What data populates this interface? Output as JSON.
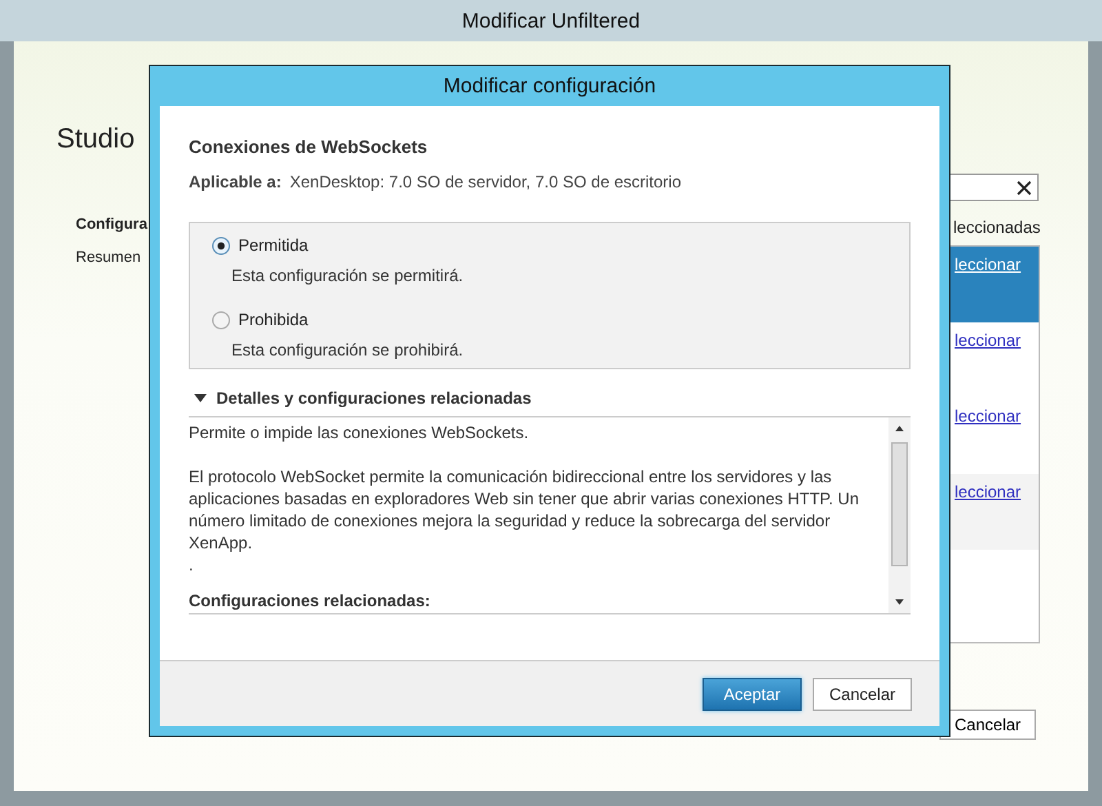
{
  "background_window": {
    "title": "Modificar Unfiltered",
    "heading": "Studio",
    "steps": [
      {
        "label": "Configura",
        "selected": true
      },
      {
        "label": "Resumen",
        "selected": false
      }
    ],
    "list_header": "leccionadas",
    "rows": [
      {
        "link": "leccionar",
        "selected": true
      },
      {
        "link": "leccionar",
        "selected": false
      },
      {
        "link": "leccionar",
        "selected": false
      },
      {
        "link": "leccionar",
        "selected": false
      }
    ],
    "cancel_button": "Cancelar"
  },
  "dialog": {
    "title": "Modificar configuración",
    "setting_name": "Conexiones de WebSockets",
    "applies_label": "Aplicable a:",
    "applies_value": "XenDesktop: 7.0 SO de servidor, 7.0 SO de escritorio",
    "options": [
      {
        "label": "Permitida",
        "description": "Esta configuración se permitirá.",
        "selected": true
      },
      {
        "label": "Prohibida",
        "description": "Esta configuración se prohibirá.",
        "selected": false
      }
    ],
    "details": {
      "label": "Detalles y configuraciones relacionadas",
      "expanded": true,
      "paragraphs": [
        "Permite o impide las conexiones WebSockets.",
        "El protocolo WebSocket permite la comunicación bidireccional entre los servidores y las aplicaciones basadas en exploradores Web sin tener que abrir varias conexiones HTTP. Un número limitado de conexiones mejora la seguridad y reduce la sobrecarga del servidor XenApp.",
        "."
      ],
      "related_heading": "Configuraciones relacionadas:"
    },
    "buttons": [
      {
        "label": "Aceptar",
        "kind": "primary"
      },
      {
        "label": "Cancelar",
        "kind": "secondary"
      }
    ]
  }
}
